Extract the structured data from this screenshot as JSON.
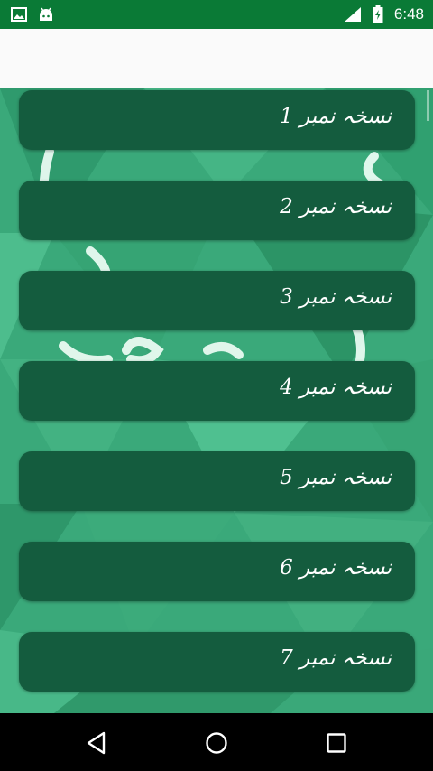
{
  "status_bar": {
    "time": "6:48",
    "icons": [
      "image-icon",
      "android-icon",
      "signal-icon",
      "battery-charging-icon"
    ]
  },
  "items": [
    {
      "label": "نسخہ نمبر 1"
    },
    {
      "label": "نسخہ نمبر 2"
    },
    {
      "label": "نسخہ نمبر 3"
    },
    {
      "label": "نسخہ نمبر 4"
    },
    {
      "label": "نسخہ نمبر 5"
    },
    {
      "label": "نسخہ نمبر 6"
    },
    {
      "label": "نسخہ نمبر 7"
    }
  ],
  "colors": {
    "status_bar": "#0a7a36",
    "card": "#145c3e",
    "background": "#39a779",
    "nav_bar": "#000000"
  },
  "nav_bar": {
    "icons": [
      "back-icon",
      "home-icon",
      "recents-icon"
    ]
  }
}
